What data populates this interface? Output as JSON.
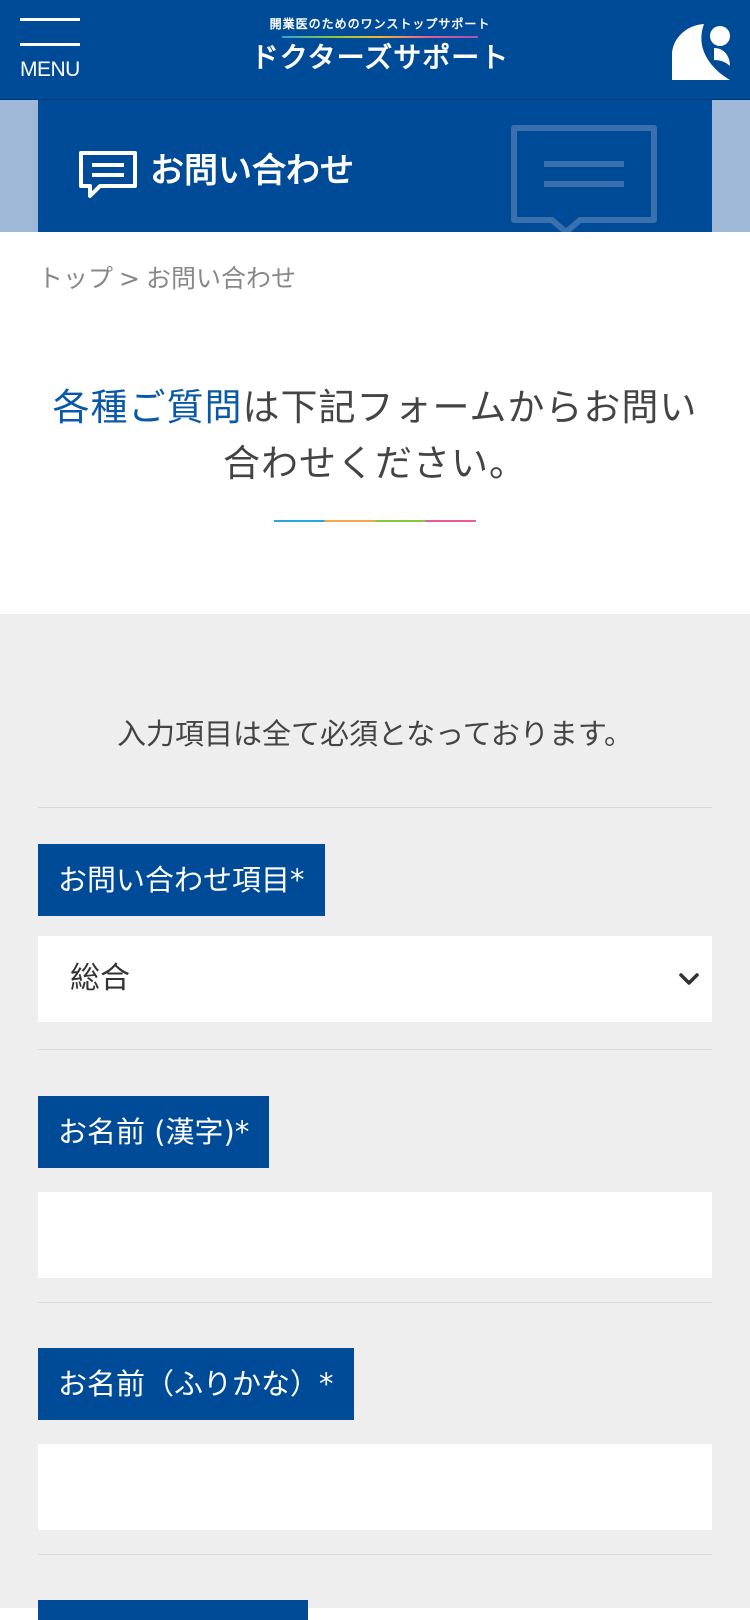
{
  "header": {
    "menu_label": "MENU",
    "logo_tagline": "開業医のためのワンストップサポート",
    "logo_name": "ドクターズサポート",
    "brand_color": "#004b98"
  },
  "banner": {
    "title": "お問い合わせ",
    "icon": "speech-bubble-icon"
  },
  "breadcrumb": {
    "home": "トップ",
    "separator": ">",
    "current": "お問い合わせ"
  },
  "lead": {
    "accent": "各種ご質問",
    "rest": "は下記フォームからお問い合わせください。",
    "accent_color": "#0a58a8"
  },
  "form": {
    "note": "入力項目は全て必須となっております。",
    "fields": [
      {
        "label": "お問い合わせ項目*",
        "type": "select",
        "value": "総合"
      },
      {
        "label": "お名前 (漢字)*",
        "type": "text",
        "value": ""
      },
      {
        "label": "お名前（ふりかな）*",
        "type": "text",
        "value": ""
      }
    ]
  }
}
